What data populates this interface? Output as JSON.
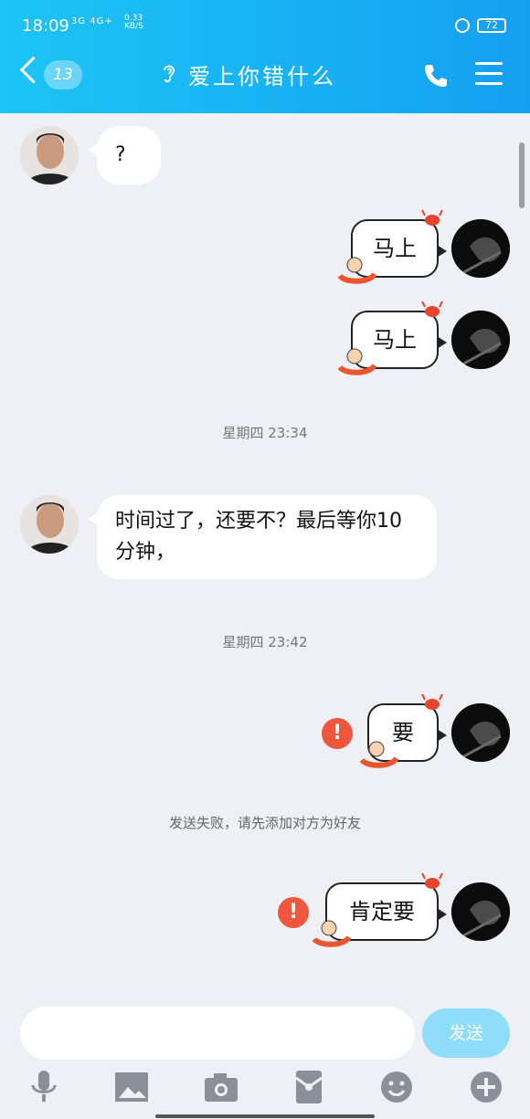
{
  "status": {
    "time": "18:09",
    "signal": "3G 4G+",
    "speed": "0.33",
    "speed_unit": "KB/S",
    "battery": "72"
  },
  "header": {
    "unread_count": "13",
    "title": "爱上你错什么"
  },
  "messages": [
    {
      "from": "friend",
      "text": "?"
    },
    {
      "from": "me",
      "text": "马上"
    },
    {
      "from": "me",
      "text": "马上"
    },
    {
      "type": "time",
      "text": "星期四 23:34"
    },
    {
      "from": "friend",
      "text": "时间过了，还要不？最后等你10分钟，"
    },
    {
      "type": "time",
      "text": "星期四 23:42"
    },
    {
      "from": "me",
      "text": "要",
      "failed": true
    },
    {
      "type": "system",
      "text": "发送失败，请先添加对方为好友"
    },
    {
      "from": "me",
      "text": "肯定要",
      "failed": true
    }
  ],
  "input": {
    "value": "",
    "send_label": "发送"
  },
  "toolbar_icons": [
    "microphone-icon",
    "image-icon",
    "camera-icon",
    "red-packet-icon",
    "emoji-icon",
    "plus-icon"
  ],
  "colors": {
    "header_start": "#1ec4f5",
    "header_end": "#159ff0",
    "send_button": "#8fdcfb",
    "error_badge": "#f0553e"
  }
}
